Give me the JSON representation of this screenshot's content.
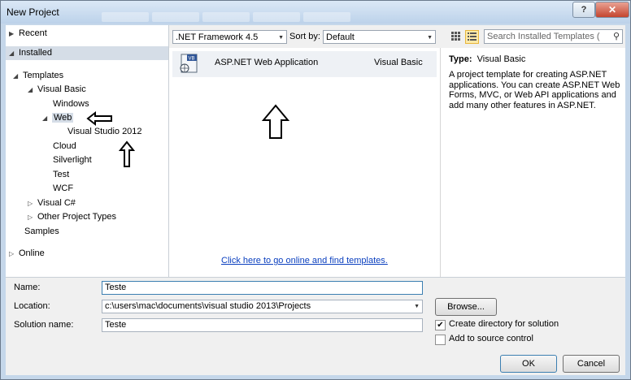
{
  "window": {
    "title": "New Project",
    "help_label": "?",
    "close_label": "✕"
  },
  "tree": {
    "recent": "Recent",
    "installed": "Installed",
    "templates": "Templates",
    "visual_basic": "Visual Basic",
    "windows": "Windows",
    "web": "Web",
    "visual_studio_2012": "Visual Studio 2012",
    "cloud": "Cloud",
    "silverlight": "Silverlight",
    "test": "Test",
    "wcf": "WCF",
    "visual_csharp": "Visual C#",
    "other_project_types": "Other Project Types",
    "samples": "Samples",
    "online": "Online"
  },
  "toolbar": {
    "framework": ".NET Framework 4.5",
    "sort_by_label": "Sort by:",
    "sort_by_value": "Default",
    "search_placeholder": "Search Installed Templates ("
  },
  "templates": [
    {
      "name": "ASP.NET Web Application",
      "type": "Visual Basic",
      "icon_text": "VB"
    }
  ],
  "online_link": "Click here to go online and find templates.",
  "details": {
    "type_label": "Type:",
    "type_value": "Visual Basic",
    "description": "A project template for creating ASP.NET applications. You can create ASP.NET Web Forms, MVC,  or Web API applications and add many other features in ASP.NET."
  },
  "form": {
    "name_label": "Name:",
    "name_value": "Teste",
    "location_label": "Location:",
    "location_value": "c:\\users\\mac\\documents\\visual studio 2013\\Projects",
    "solution_label": "Solution name:",
    "solution_value": "Teste",
    "browse_label": "Browse...",
    "create_dir_label": "Create directory for solution",
    "create_dir_checked": true,
    "add_source_label": "Add to source control",
    "add_source_checked": false,
    "ok_label": "OK",
    "cancel_label": "Cancel"
  },
  "colors": {
    "accent": "#0a3fbf",
    "selection": "#d5dde7",
    "title_bar": "#c5d7ea"
  }
}
